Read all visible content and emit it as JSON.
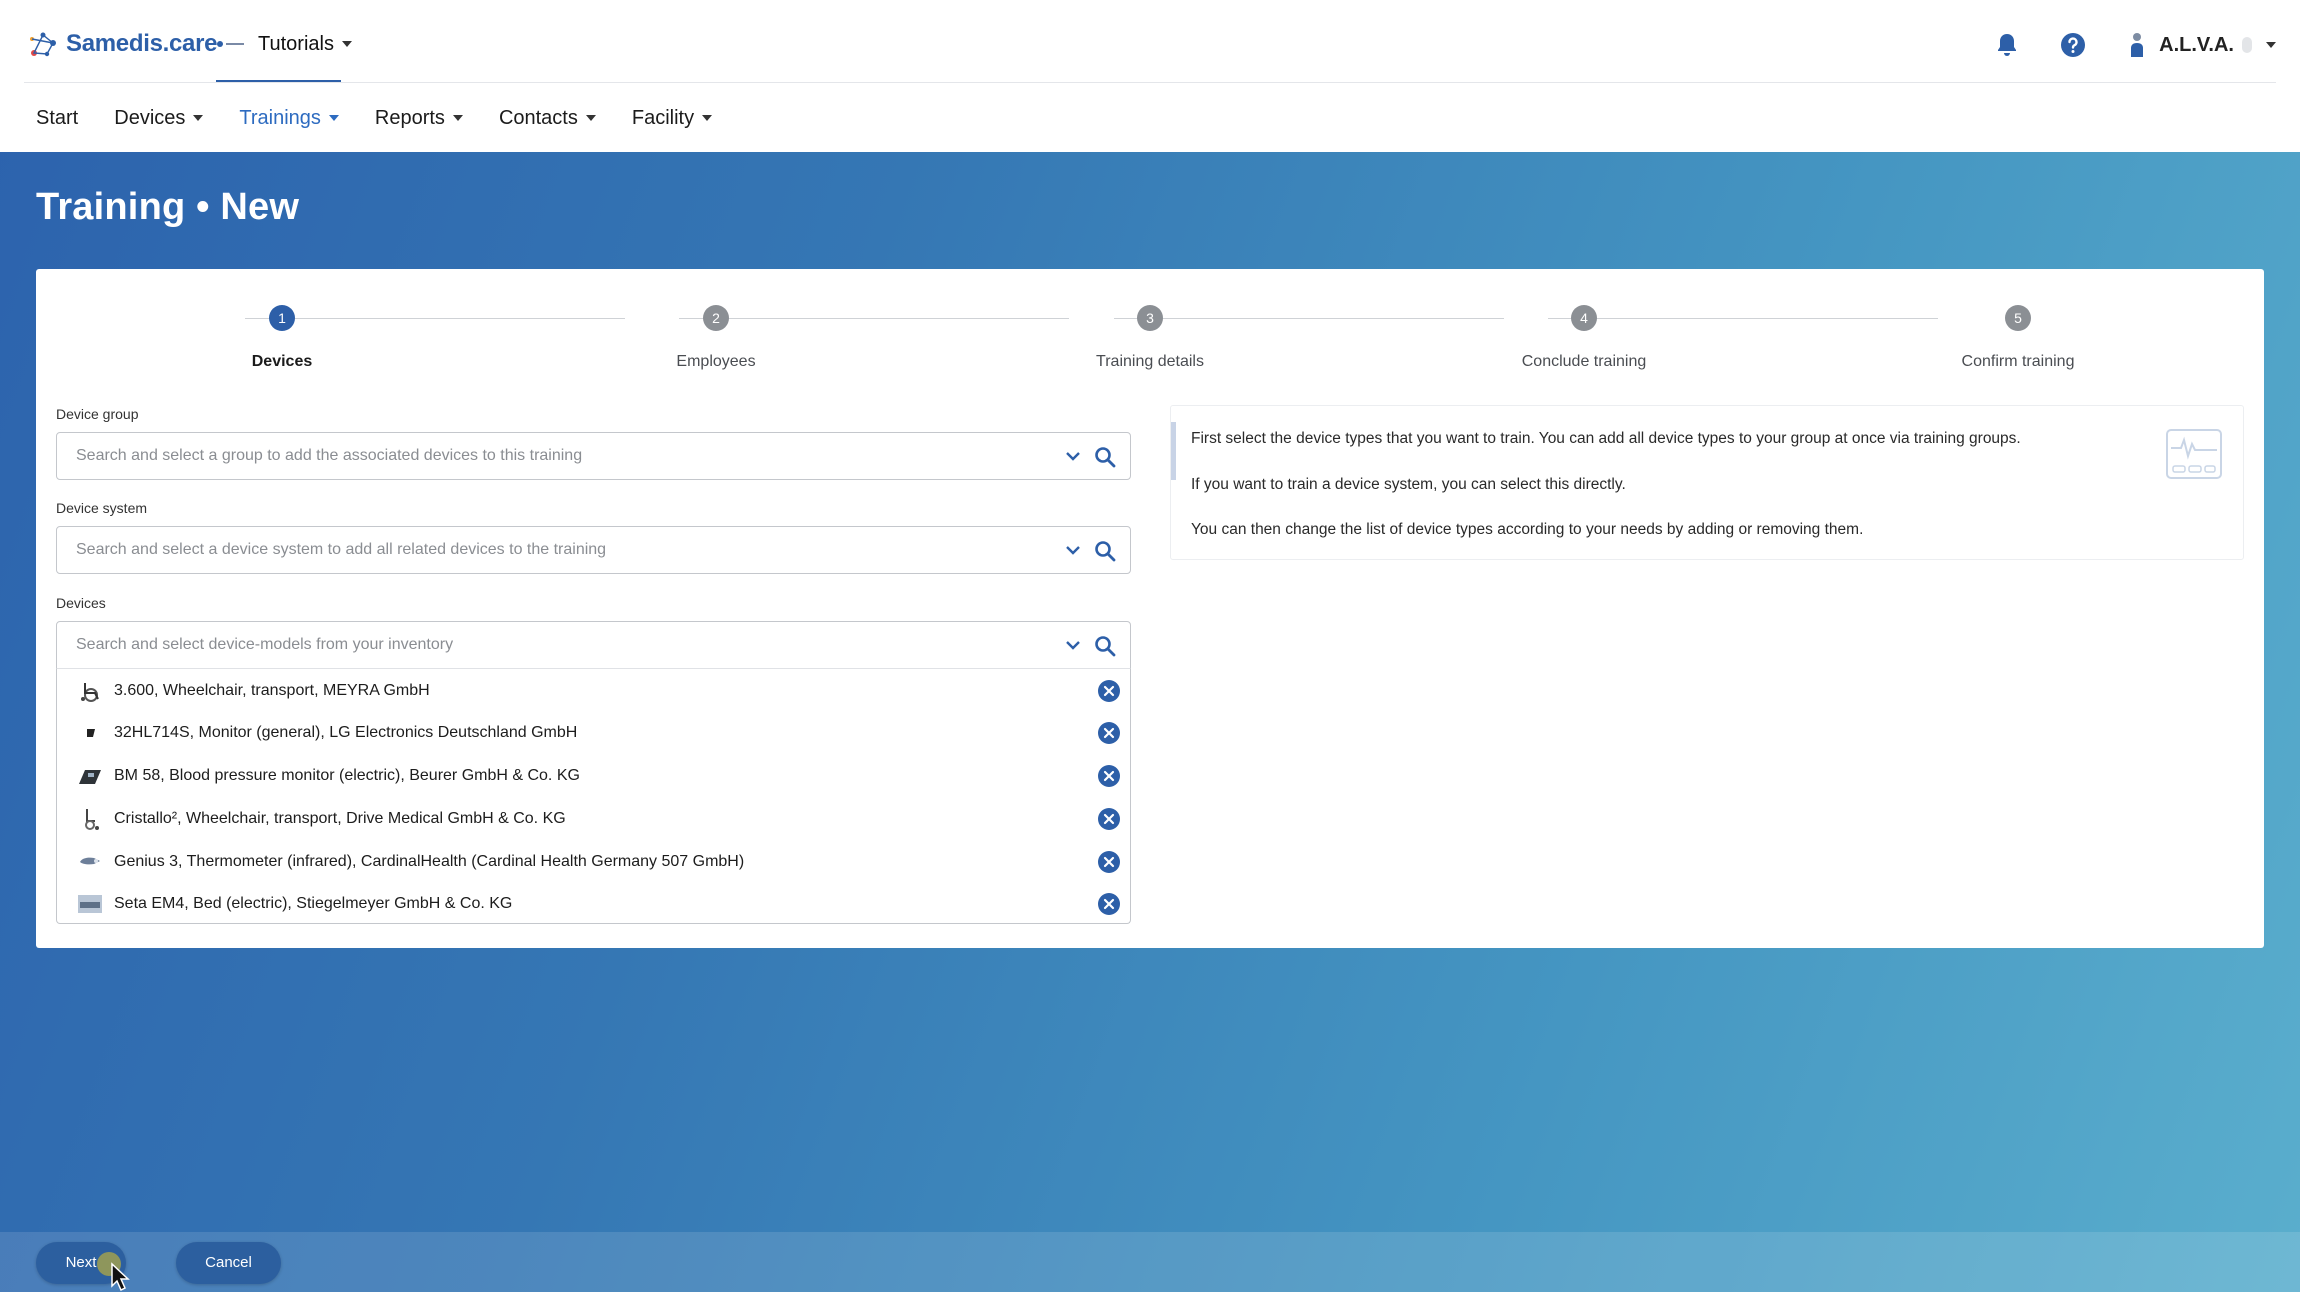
{
  "brand": {
    "name": "Samedis.care"
  },
  "tenant": {
    "label": "Tutorials"
  },
  "user": {
    "name": "A.L.V.A."
  },
  "nav": {
    "items": [
      {
        "label": "Start",
        "has_menu": false,
        "active": false
      },
      {
        "label": "Devices",
        "has_menu": true,
        "active": false
      },
      {
        "label": "Trainings",
        "has_menu": true,
        "active": true
      },
      {
        "label": "Reports",
        "has_menu": true,
        "active": false
      },
      {
        "label": "Contacts",
        "has_menu": true,
        "active": false
      },
      {
        "label": "Facility",
        "has_menu": true,
        "active": false
      }
    ]
  },
  "page": {
    "title": "Training • New"
  },
  "stepper": {
    "steps": [
      {
        "number": "1",
        "label": "Devices",
        "active": true
      },
      {
        "number": "2",
        "label": "Employees",
        "active": false
      },
      {
        "number": "3",
        "label": "Training details",
        "active": false
      },
      {
        "number": "4",
        "label": "Conclude training",
        "active": false
      },
      {
        "number": "5",
        "label": "Confirm training",
        "active": false
      }
    ]
  },
  "form": {
    "device_group": {
      "label": "Device group",
      "placeholder": "Search and select a group to add the associated devices to this training"
    },
    "device_system": {
      "label": "Device system",
      "placeholder": "Search and select a device system to add all related devices to the training"
    },
    "devices": {
      "label": "Devices",
      "placeholder": "Search and select device-models from your inventory",
      "selected": [
        {
          "label": "3.600, Wheelchair, transport, MEYRA GmbH",
          "thumb": "wheelchair-thumbnail"
        },
        {
          "label": "32HL714S, Monitor (general), LG Electronics Deutschland GmbH",
          "thumb": "monitor-thumbnail"
        },
        {
          "label": "BM 58, Blood pressure monitor (electric), Beurer GmbH & Co. KG",
          "thumb": "blood-pressure-monitor-thumbnail"
        },
        {
          "label": "Cristallo², Wheelchair, transport, Drive Medical GmbH & Co. KG",
          "thumb": "wheelchair-thumbnail"
        },
        {
          "label": "Genius 3, Thermometer (infrared), CardinalHealth (Cardinal Health Germany 507 GmbH)",
          "thumb": "thermometer-thumbnail"
        },
        {
          "label": "Seta EM4, Bed (electric), Stiegelmeyer GmbH & Co. KG",
          "thumb": "bed-thumbnail"
        }
      ]
    }
  },
  "info": {
    "lines": [
      "First select the device types that you want to train. You can add all device types to your group at once via training groups.",
      "If you want to train a device system, you can select this directly.",
      "You can then change the list of device types according to your needs by adding or removing them."
    ]
  },
  "footer": {
    "next_label": "Next",
    "cancel_label": "Cancel"
  },
  "colors": {
    "brand": "#2d5fa8",
    "accent": "#2d6bc0",
    "step_inactive": "#8b8f94"
  }
}
